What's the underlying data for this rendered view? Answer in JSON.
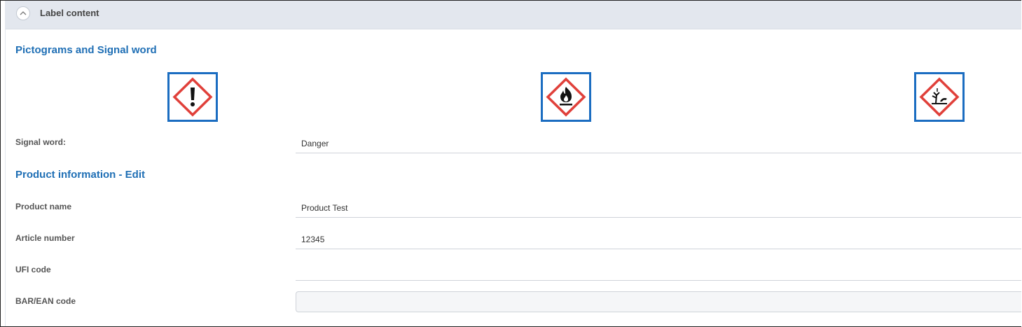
{
  "panel": {
    "title": "Label content",
    "toggle_icon": "chevron-up-icon",
    "header_bg": "#e3e7ee"
  },
  "pictograms_section": {
    "title": "Pictograms and Signal word",
    "pictograms": [
      {
        "name": "exclamation-mark-pictogram-icon"
      },
      {
        "name": "flame-pictogram-icon"
      },
      {
        "name": "environment-pictogram-icon"
      }
    ],
    "signal_word_label": "Signal word:",
    "signal_word_value": "Danger"
  },
  "product_section": {
    "title": "Product information - Edit",
    "fields": [
      {
        "label": "Product name",
        "value": "Product Test"
      },
      {
        "label": "Article number",
        "value": "12345"
      },
      {
        "label": "UFI code",
        "value": ""
      },
      {
        "label": "BAR/EAN code",
        "value": ""
      }
    ]
  },
  "colors": {
    "section_title": "#1f6fb5",
    "pictogram_border": "#1b6dc1",
    "pictogram_diamond": "#e0403a"
  }
}
